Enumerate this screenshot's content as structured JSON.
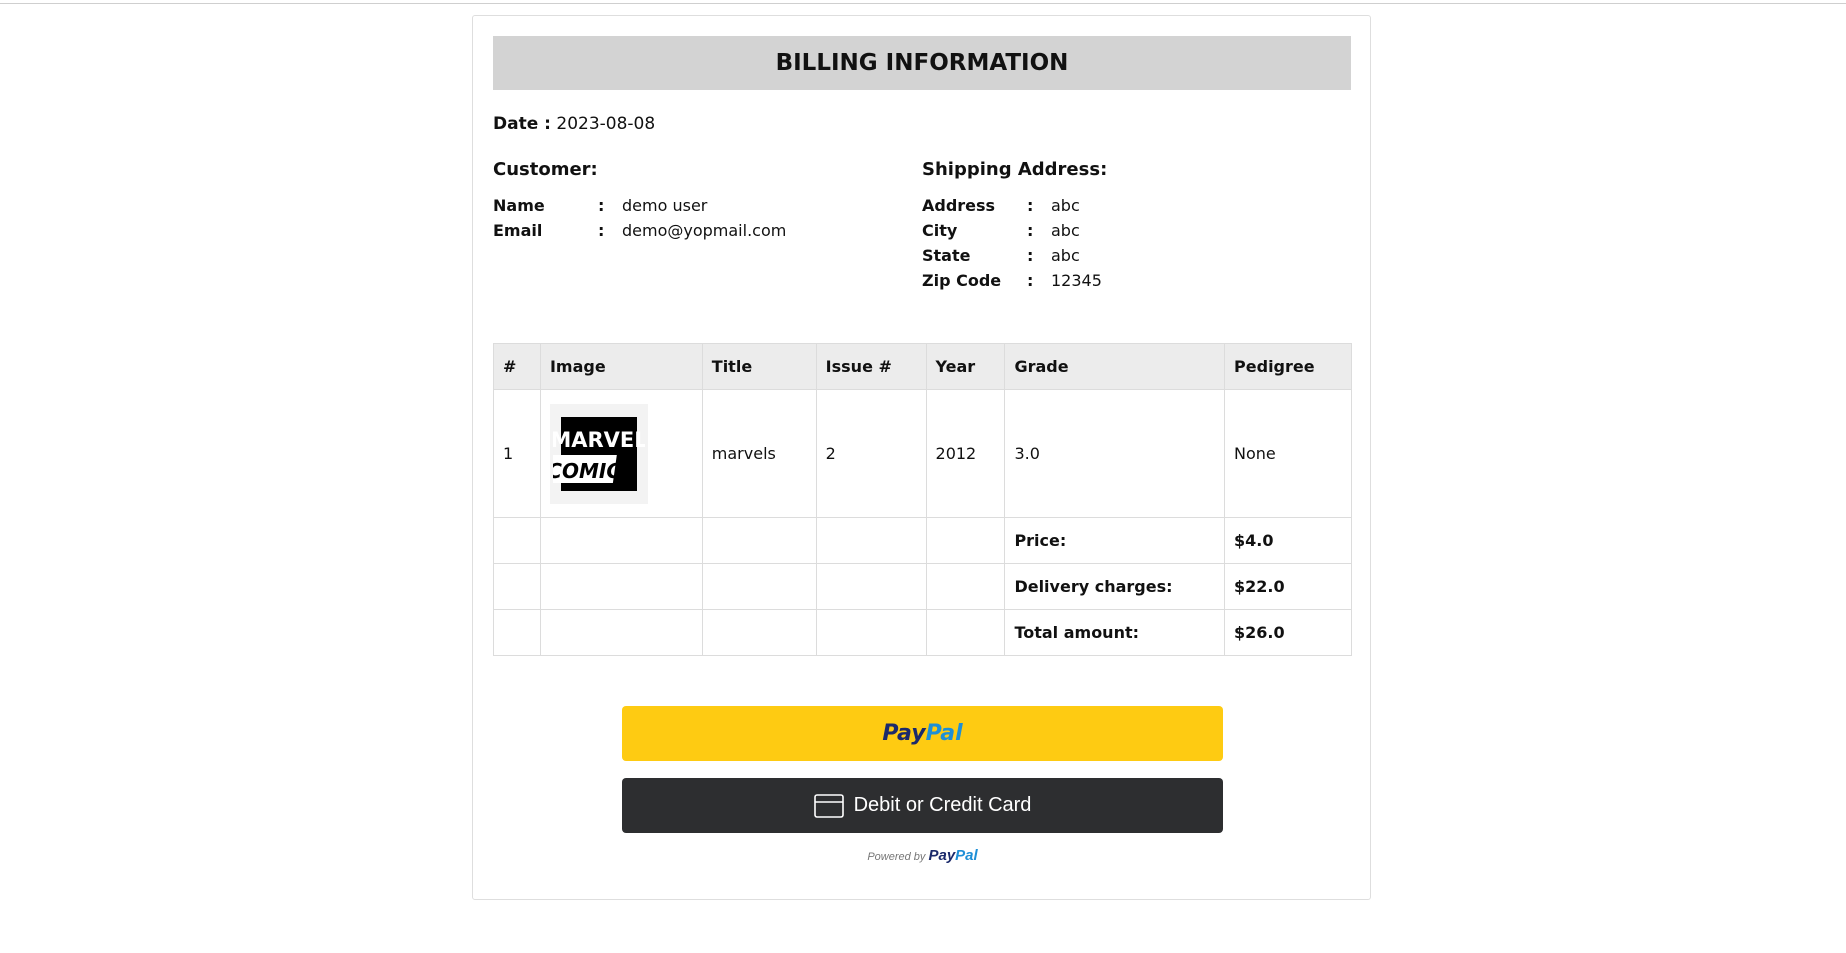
{
  "billing": {
    "title": "BILLING INFORMATION",
    "date_label": "Date :",
    "date_value": "2023-08-08"
  },
  "customer": {
    "heading": "Customer:",
    "fields": [
      {
        "label": "Name",
        "sep": ":",
        "value": "demo user"
      },
      {
        "label": "Email",
        "sep": ":",
        "value": "demo@yopmail.com"
      }
    ]
  },
  "shipping": {
    "heading": "Shipping Address:",
    "fields": [
      {
        "label": "Address",
        "sep": ":",
        "value": "abc"
      },
      {
        "label": "City",
        "sep": ":",
        "value": "abc"
      },
      {
        "label": "State",
        "sep": ":",
        "value": "abc"
      },
      {
        "label": "Zip Code",
        "sep": ":",
        "value": "12345"
      }
    ]
  },
  "table": {
    "headers": [
      "#",
      "Image",
      "Title",
      "Issue #",
      "Year",
      "Grade",
      "Pedigree"
    ],
    "rows": [
      {
        "num": "1",
        "image_icon": "marvel-comics-logo",
        "image_text_top": "MARVEL",
        "image_text_bottom": "COMICS",
        "title": "marvels",
        "issue": "2",
        "year": "2012",
        "grade": "3.0",
        "pedigree": "None"
      }
    ],
    "summary": [
      {
        "label": "Price:",
        "value": "$4.0"
      },
      {
        "label": "Delivery charges:",
        "value": "$22.0"
      },
      {
        "label": "Total amount:",
        "value": "$26.0"
      }
    ]
  },
  "payment": {
    "paypal_dark": "Pay",
    "paypal_light": "Pal",
    "card_icon": "credit-card-icon",
    "card_label": "Debit or Credit Card",
    "powered_by": "Powered by",
    "powered_logo_dark": "Pay",
    "powered_logo_light": "Pal"
  },
  "colors": {
    "banner": "#d3d3d3",
    "paypal_button": "#fecb12",
    "card_button": "#2d2e30",
    "paypal_dark": "#1b2a6b",
    "paypal_light": "#1e8fd6"
  }
}
